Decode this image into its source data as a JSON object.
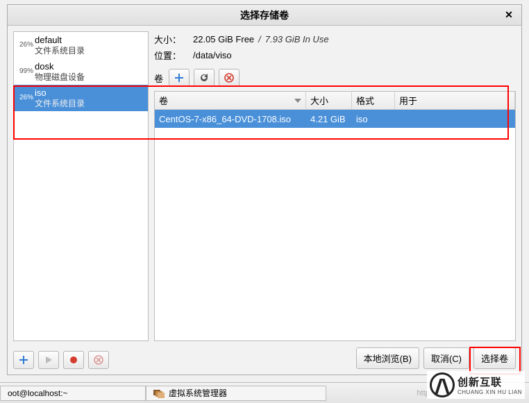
{
  "window": {
    "title": "选择存储卷",
    "close_label": "✕"
  },
  "pools": [
    {
      "pct": "26%",
      "name": "default",
      "sub": "文件系统目录"
    },
    {
      "pct": "99%",
      "name": "dosk",
      "sub": "物理磁盘设备"
    },
    {
      "pct": "26%",
      "name": "iso",
      "sub": "文件系统目录"
    }
  ],
  "info": {
    "size_label": "大小：",
    "free": "22.05 GiB Free",
    "inuse_sep": "/",
    "inuse": "7.93 GiB In Use",
    "loc_label": "位置：",
    "loc_value": "/data/viso"
  },
  "vol_toolbar": {
    "label": "卷"
  },
  "columns": {
    "vol": "卷",
    "size": "大小",
    "fmt": "格式",
    "use": "用于"
  },
  "rows": [
    {
      "vol": "CentOS-7-x86_64-DVD-1708.iso",
      "size": "4.21 GiB",
      "fmt": "iso",
      "use": ""
    }
  ],
  "buttons": {
    "browse": "本地浏览(B)",
    "cancel": "取消(C)",
    "choose": "选择卷"
  },
  "taskbar": {
    "term": "oot@localhost:~",
    "vmm": "虚拟系统管理器",
    "url_hint": "https://bl"
  },
  "watermark": {
    "cn": "创新互联",
    "en": "CHUANG XIN HU LIAN"
  }
}
